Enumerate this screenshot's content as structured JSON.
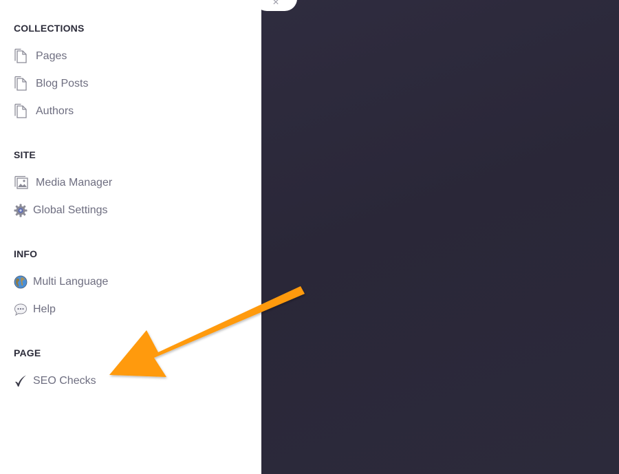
{
  "close_glyph": "×",
  "sections": [
    {
      "title": "COLLECTIONS",
      "items": [
        {
          "label": "Pages",
          "icon": "page-icon"
        },
        {
          "label": "Blog Posts",
          "icon": "page-icon"
        },
        {
          "label": "Authors",
          "icon": "page-icon"
        }
      ]
    },
    {
      "title": "SITE",
      "items": [
        {
          "label": "Media Manager",
          "icon": "image-icon"
        },
        {
          "label": "Global Settings",
          "icon": "gear-icon"
        }
      ]
    },
    {
      "title": "INFO",
      "items": [
        {
          "label": "Multi Language",
          "icon": "globe-icon"
        },
        {
          "label": "Help",
          "icon": "speech-bubble-icon"
        }
      ]
    },
    {
      "title": "PAGE",
      "items": [
        {
          "label": "SEO Checks",
          "icon": "checkmark-icon"
        }
      ]
    }
  ],
  "colors": {
    "sidebar_bg": "#ffffff",
    "overlay_bg": "#2b2839",
    "section_title": "#2c2c3a",
    "item_label": "#6e6e80",
    "annotation_arrow": "#ff9a0a"
  }
}
